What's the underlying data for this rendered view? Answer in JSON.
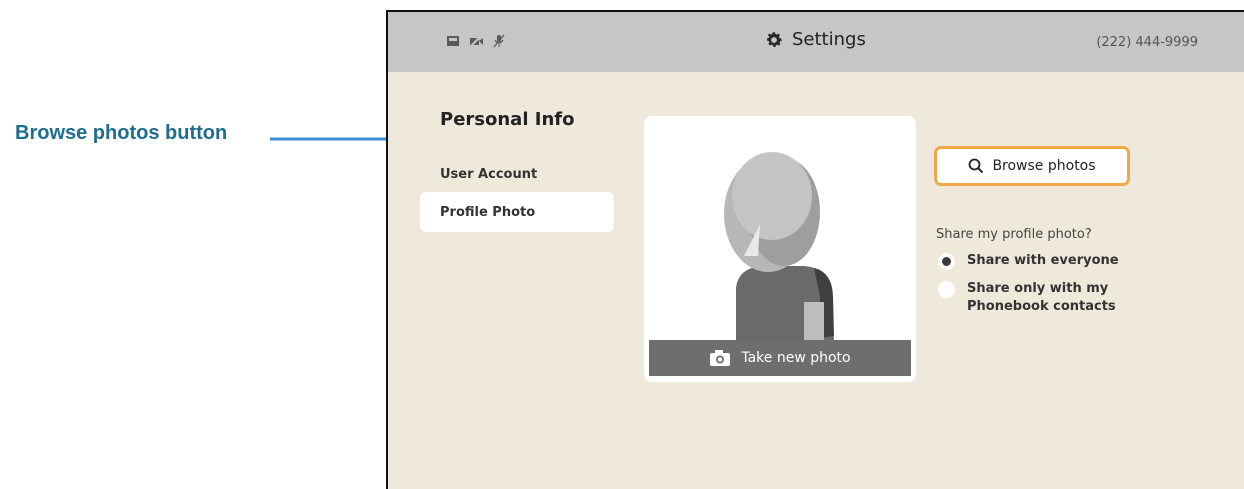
{
  "callout": {
    "label": "Browse photos button",
    "color": "#1f6d8f",
    "arrow_color": "#3d8fd6"
  },
  "topbar": {
    "status_icons": [
      "video-icon",
      "video-off-icon",
      "mic-off-icon"
    ],
    "title": "Settings",
    "title_icon": "gear-icon",
    "phone_number": "(222) 444-9999"
  },
  "sidebar": {
    "section_title": "Personal Info",
    "items": [
      {
        "label": "User Account",
        "selected": false
      },
      {
        "label": "Profile Photo",
        "selected": true
      }
    ]
  },
  "photo": {
    "take_photo_label": "Take new photo",
    "take_photo_icon": "camera-icon"
  },
  "browse": {
    "label": "Browse photos",
    "icon": "search-icon",
    "focus_color": "#f0a848"
  },
  "share": {
    "question": "Share my profile photo?",
    "options": [
      {
        "label": "Share with everyone",
        "selected": true
      },
      {
        "label": "Share only with my Phonebook contacts",
        "selected": false
      }
    ]
  }
}
